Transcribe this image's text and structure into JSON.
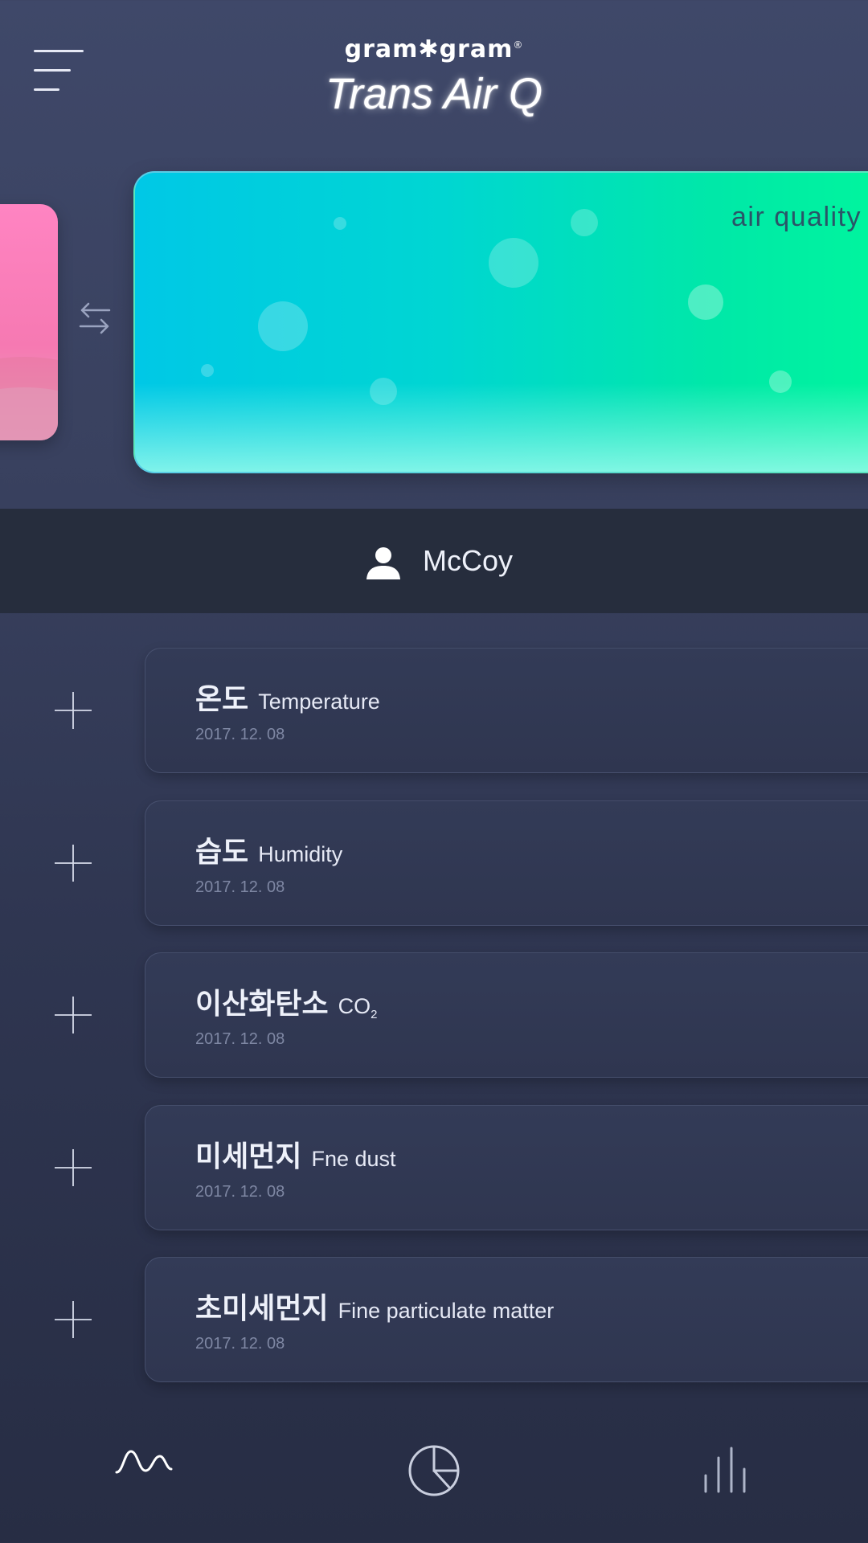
{
  "header": {
    "logo_text": "gram✱gram",
    "logo_reg": "®",
    "app_title": "Trans Air Q"
  },
  "cards": {
    "active_label": "air quality"
  },
  "user": {
    "name": "McCoy"
  },
  "sensors": [
    {
      "ko": "온도",
      "en": "Temperature",
      "date": "2017. 12. 08"
    },
    {
      "ko": "습도",
      "en": "Humidity",
      "date": "2017. 12. 08"
    },
    {
      "ko": "이산화탄소",
      "en": "CO",
      "en_sub": "2",
      "date": "2017. 12. 08"
    },
    {
      "ko": "미세먼지",
      "en": "Fne dust",
      "date": "2017. 12. 08"
    },
    {
      "ko": "초미세먼지",
      "en": "Fine particulate matter",
      "date": "2017. 12. 08"
    }
  ],
  "icons": {
    "menu": "hamburger-menu-icon",
    "swap": "swap-arrows-icon",
    "user": "user-icon",
    "add": "plus-icon",
    "nav": [
      "wave-icon",
      "pie-chart-icon",
      "bar-chart-icon"
    ]
  },
  "colors": {
    "background_top": "#3f4869",
    "background_bottom": "#272d44",
    "user_bar": "#262d3d",
    "air_gradient_start": "#00c8e6",
    "air_gradient_end": "#00f79c",
    "pink_card": "#ff84c2"
  }
}
